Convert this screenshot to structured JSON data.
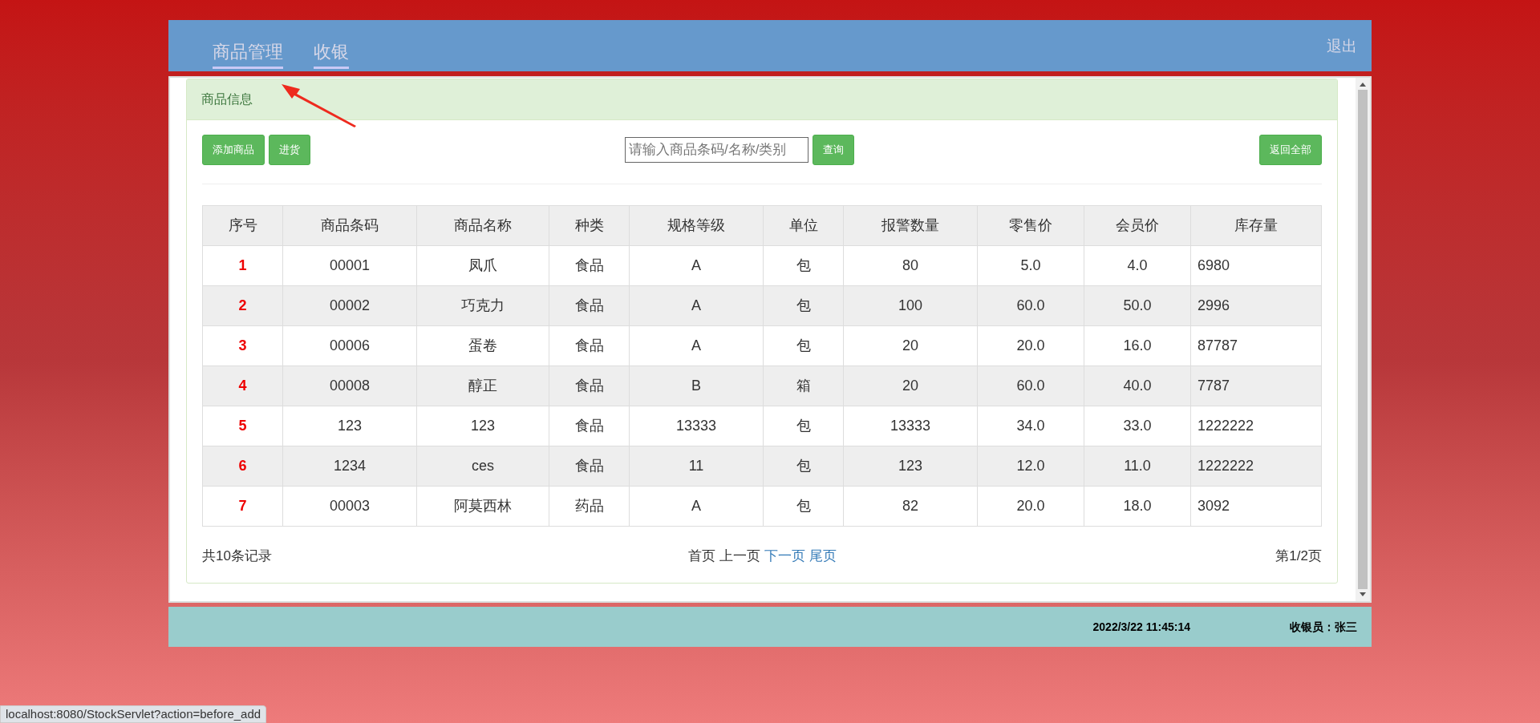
{
  "nav": {
    "tabs": [
      {
        "label": "商品管理"
      },
      {
        "label": "收银"
      }
    ],
    "logout": "退出"
  },
  "panel": {
    "title": "商品信息",
    "buttons": [
      "添加商品",
      "进货"
    ],
    "search": {
      "placeholder": "请输入商品条码/名称/类别",
      "button": "查询"
    },
    "reset_button": "返回全部",
    "table": {
      "columns": [
        "序号",
        "商品条码",
        "商品名称",
        "种类",
        "规格等级",
        "单位",
        "报警数量",
        "零售价",
        "会员价",
        "库存量"
      ],
      "rows": [
        [
          "1",
          "00001",
          "凤爪",
          "食品",
          "A",
          "包",
          "80",
          "5.0",
          "4.0",
          "6980"
        ],
        [
          "2",
          "00002",
          "巧克力",
          "食品",
          "A",
          "包",
          "100",
          "60.0",
          "50.0",
          "2996"
        ],
        [
          "3",
          "00006",
          "蛋卷",
          "食品",
          "A",
          "包",
          "20",
          "20.0",
          "16.0",
          "87787"
        ],
        [
          "4",
          "00008",
          "醇正",
          "食品",
          "B",
          "箱",
          "20",
          "60.0",
          "40.0",
          "7787"
        ],
        [
          "5",
          "123",
          "123",
          "食品",
          "13333",
          "包",
          "13333",
          "34.0",
          "33.0",
          "1222222"
        ],
        [
          "6",
          "1234",
          "ces",
          "食品",
          "11",
          "包",
          "123",
          "12.0",
          "11.0",
          "1222222"
        ],
        [
          "7",
          "00003",
          "阿莫西林",
          "药品",
          "A",
          "包",
          "82",
          "20.0",
          "18.0",
          "3092"
        ]
      ]
    },
    "pagination": {
      "total": "共10条记录",
      "links": [
        {
          "label": "首页",
          "disabled": true
        },
        {
          "label": "上一页",
          "disabled": true
        },
        {
          "label": "下一页",
          "disabled": false
        },
        {
          "label": "尾页",
          "disabled": false
        }
      ],
      "page": "第1/2页"
    }
  },
  "footer": {
    "datetime": "2022/3/22 11:45:14",
    "cashier": "收银员：张三"
  },
  "status_url": "localhost:8080/StockServlet?action=before_add"
}
